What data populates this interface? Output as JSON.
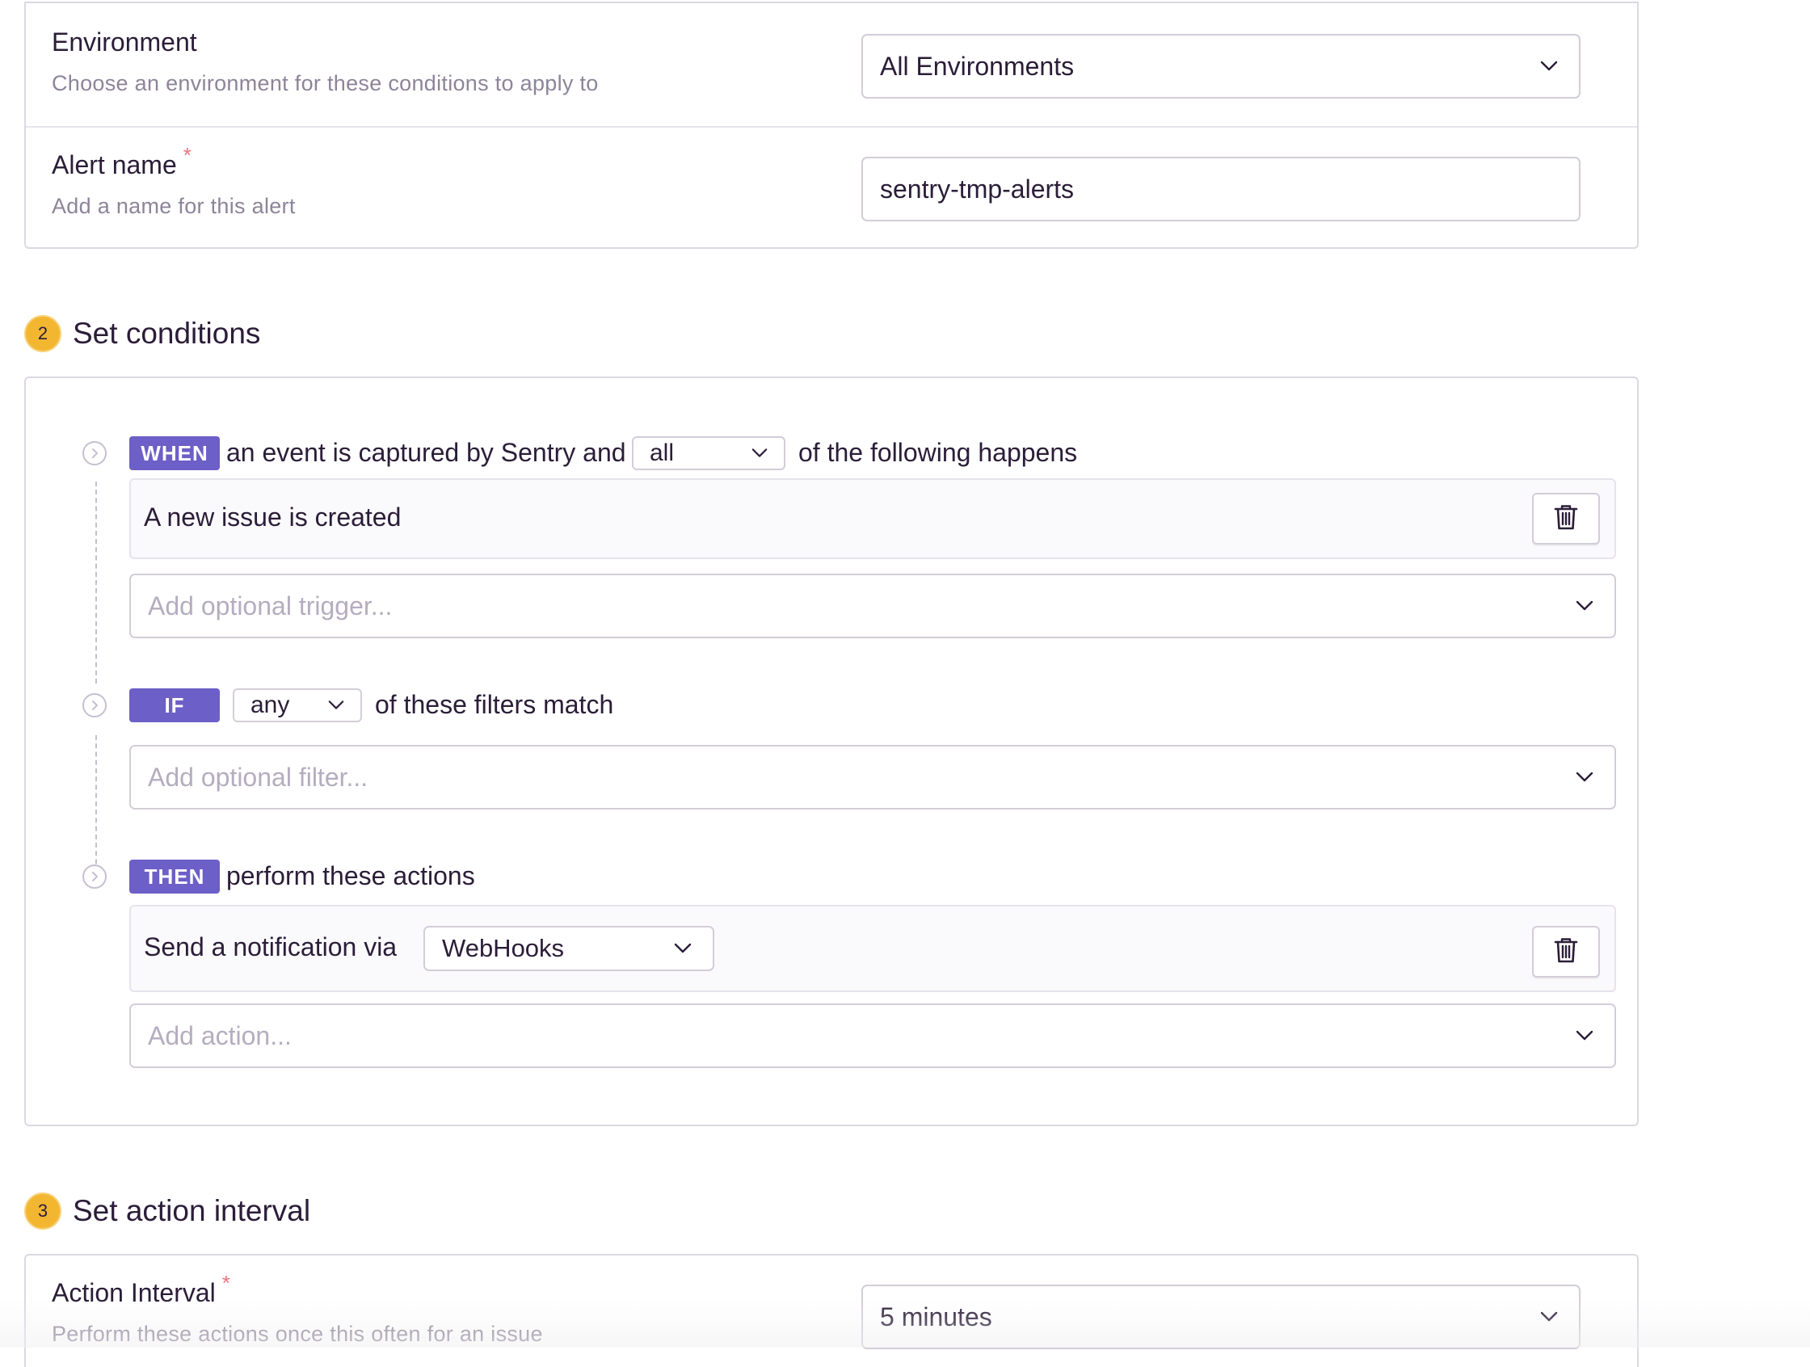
{
  "section1": {
    "environment": {
      "label": "Environment",
      "help": "Choose an environment for these conditions to apply to",
      "value": "All Environments"
    },
    "alert_name": {
      "label": "Alert name",
      "required_mark": "*",
      "help": "Add a name for this alert",
      "value": "sentry-tmp-alerts"
    }
  },
  "conditions": {
    "step_number": "2",
    "title": "Set conditions",
    "when": {
      "badge": "WHEN",
      "text_before": "an event is captured by Sentry and",
      "match_value": "all",
      "text_after": "of the following happens",
      "trigger_rule": "A new issue is created",
      "add_placeholder": "Add optional trigger..."
    },
    "if": {
      "badge": "IF",
      "match_value": "any",
      "text_after": "of these filters match",
      "add_placeholder": "Add optional filter..."
    },
    "then": {
      "badge": "THEN",
      "text_after": "perform these actions",
      "action_label": "Send a notification via",
      "action_value": "WebHooks",
      "add_placeholder": "Add action..."
    }
  },
  "interval": {
    "step_number": "3",
    "title": "Set action interval",
    "label": "Action Interval",
    "required_mark": "*",
    "help": "Perform these actions once this often for an issue",
    "value": "5 minutes"
  },
  "colors": {
    "badge": "#6c5fc7",
    "step": "#f2b630",
    "required": "#e8747f"
  }
}
